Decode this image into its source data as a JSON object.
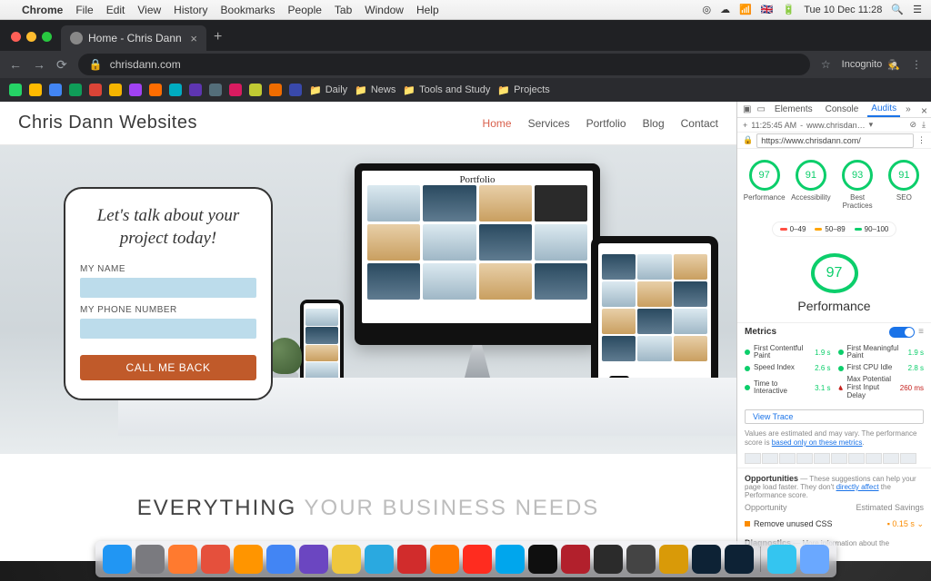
{
  "mac_menu": {
    "app": "Chrome",
    "items": [
      "File",
      "Edit",
      "View",
      "History",
      "Bookmarks",
      "People",
      "Tab",
      "Window",
      "Help"
    ],
    "clock": "Tue 10 Dec  11:28",
    "flag": "🇬🇧"
  },
  "chrome": {
    "tab_title": "Home - Chris Dann",
    "url": "chrisdann.com",
    "incognito": "Incognito",
    "bookmark_folders": [
      "Daily",
      "News",
      "Tools and Study",
      "Projects"
    ]
  },
  "site": {
    "logo": "Chris Dann Websites",
    "nav": [
      "Home",
      "Services",
      "Portfolio",
      "Blog",
      "Contact"
    ],
    "form": {
      "headline": "Let's talk about your project today!",
      "name_label": "MY NAME",
      "phone_label": "MY PHONE NUMBER",
      "cta": "CALL ME BACK"
    },
    "tagline_a": "EVERYTHING ",
    "tagline_b": "YOUR BUSINESS NEEDS"
  },
  "devtools": {
    "tabs": [
      "Elements",
      "Console",
      "Audits"
    ],
    "time": "11:25:45 AM",
    "page": "www.chrisdan…",
    "url": "https://www.chrisdann.com/",
    "gauges": [
      {
        "score": "97",
        "label": "Performance"
      },
      {
        "score": "91",
        "label": "Accessibility"
      },
      {
        "score": "93",
        "label": "Best Practices"
      },
      {
        "score": "91",
        "label": "SEO"
      }
    ],
    "legend": [
      {
        "color": "#ff4e42",
        "text": "0–49"
      },
      {
        "color": "#ffa400",
        "text": "50–89"
      },
      {
        "color": "#0cce6b",
        "text": "90–100"
      }
    ],
    "big_score": "97",
    "big_label": "Performance",
    "metrics_h": "Metrics",
    "metrics": [
      {
        "name": "First Contentful Paint",
        "val": "1.9 s",
        "ok": true
      },
      {
        "name": "First Meaningful Paint",
        "val": "1.9 s",
        "ok": true
      },
      {
        "name": "Speed Index",
        "val": "2.6 s",
        "ok": true
      },
      {
        "name": "First CPU Idle",
        "val": "2.8 s",
        "ok": true
      },
      {
        "name": "Time to Interactive",
        "val": "3.1 s",
        "ok": true
      },
      {
        "name": "Max Potential First Input Delay",
        "val": "260 ms",
        "ok": false
      }
    ],
    "view_trace": "View Trace",
    "note_a": "Values are estimated and may vary. The performance score is ",
    "note_link": "based only on these metrics",
    "opps_h": "Opportunities",
    "opps_d": " — These suggestions can help your page load faster. They don't ",
    "opps_link": "directly affect",
    "opps_d2": " the Performance score.",
    "opcol_a": "Opportunity",
    "opcol_b": "Estimated Savings",
    "op_item": "Remove unused CSS",
    "op_val": "0.15 s",
    "diag": "Diagnostics"
  },
  "dock_colors": [
    "#2196f3",
    "#7a7a7f",
    "#ff7a2f",
    "#e5503c",
    "#ff9500",
    "#4285f4",
    "#6b46c1",
    "#efc73e",
    "#2aa9e0",
    "#d12c2c",
    "#ff7a00",
    "#ff2c1f",
    "#00a6ed",
    "#0f0f0f",
    "#b2202c",
    "#2b2b2b",
    "#444444",
    "#d99a08",
    "#0d2235",
    "#0d2235",
    "#34c5f0",
    "#6aa8ff"
  ]
}
